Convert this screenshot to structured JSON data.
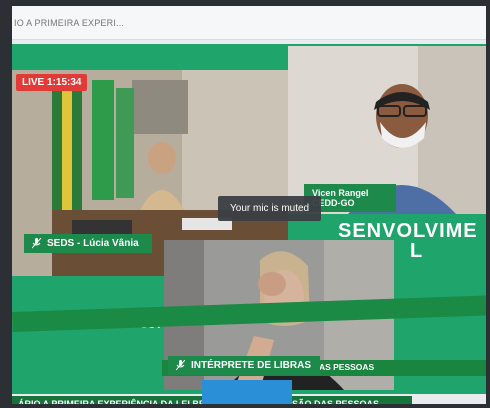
{
  "page": {
    "title": "IO A PRIMEIRA EXPERI..."
  },
  "stream": {
    "live_badge": "LIVE 1:15:34",
    "toast": "Your mic is muted"
  },
  "participants": [
    {
      "name": "SEDS - Lúcia Vânia"
    },
    {
      "name": "Vicen Rangel CEDD-GO"
    },
    {
      "name": "INTÉRPRETE DE LIBRAS"
    }
  ],
  "background": {
    "headline_line1": "SENVOLVIME",
    "headline_line2": "L",
    "gov_text": "GOV",
    "banner_text": "DA LEI BRASILEIRA DE INCLUSÃO DAS PESSOAS",
    "bottom_banner_text": "ÁRIO A PRIMEIRA EXPERIÊNCIA DA LEI BRASILEIRA DE INCLUSÃO DAS PESSOAS"
  },
  "colors": {
    "stage_green": "#1fa56b",
    "label_green": "#1d8a4c",
    "live_red": "#e23a36",
    "toast_bg": "#3b3f44"
  },
  "icons": {
    "mic": "mic-muted-icon"
  }
}
